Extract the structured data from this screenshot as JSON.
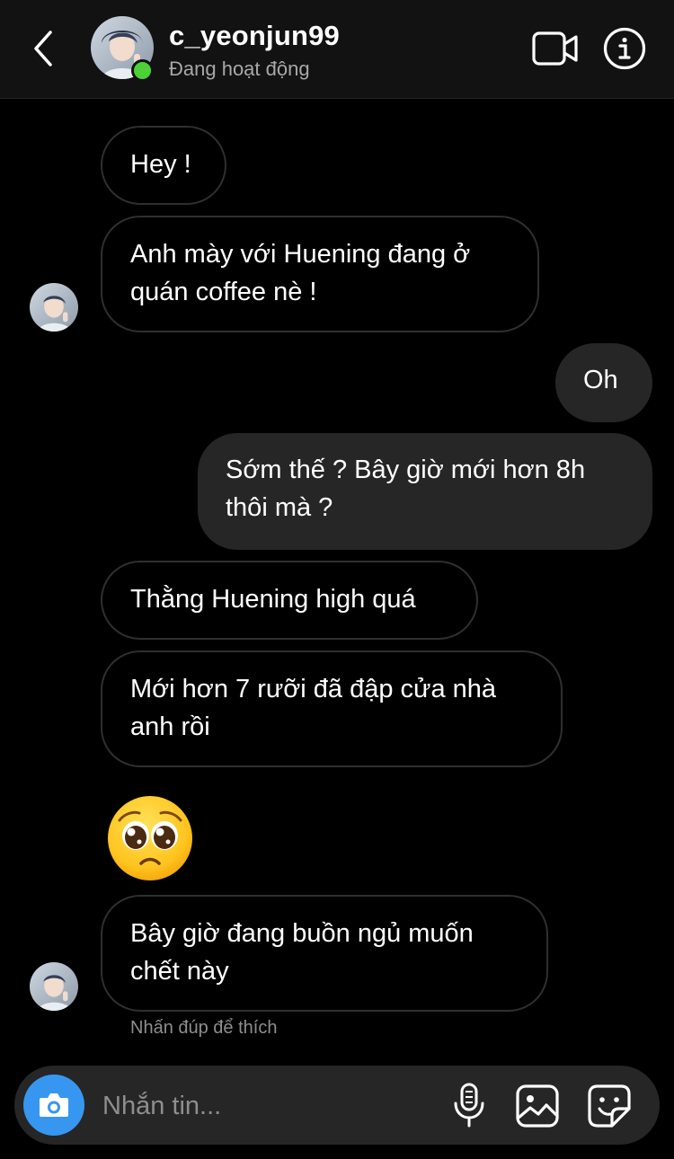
{
  "header": {
    "username": "c_yeonjun99",
    "status": "Đang hoạt động",
    "icons": {
      "back": "chevron-left-icon",
      "video": "video-camera-icon",
      "info": "info-icon"
    }
  },
  "messages": [
    {
      "direction": "incoming",
      "text": "Hey !"
    },
    {
      "direction": "incoming",
      "text": "Anh mày với Huening đang ở quán coffee nè !"
    },
    {
      "direction": "outgoing",
      "text": "Oh"
    },
    {
      "direction": "outgoing",
      "text": "Sớm thế ? Bây giờ mới hơn 8h thôi mà ?"
    },
    {
      "direction": "incoming",
      "text": "Thằng Huening high quá"
    },
    {
      "direction": "incoming",
      "text": "Mới hơn 7 rưỡi đã đập cửa nhà anh rồi"
    },
    {
      "direction": "incoming",
      "type": "emoji",
      "emoji": "pleading-face"
    },
    {
      "direction": "incoming",
      "text": "Bây giờ đang buồn ngủ muốn chết này"
    }
  ],
  "hint": "Nhấn đúp để thích",
  "composer": {
    "placeholder": "Nhắn tin...",
    "icons": [
      "camera-icon",
      "microphone-icon",
      "gallery-icon",
      "sticker-icon"
    ]
  },
  "colors": {
    "background": "#000000",
    "header": "#121212",
    "outgoing_bubble": "#262626",
    "incoming_border": "#2f2f2f",
    "online": "#4cd137",
    "camera_button": "#3797f0"
  }
}
